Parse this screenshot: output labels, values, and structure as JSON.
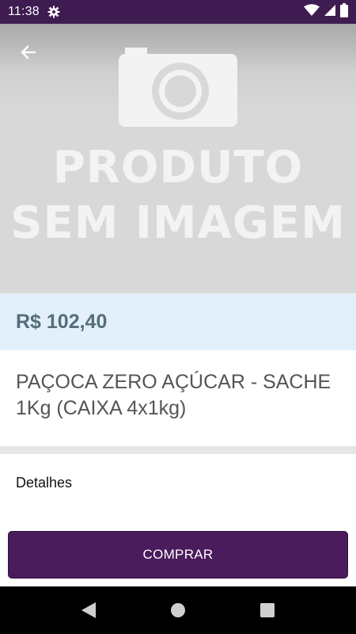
{
  "status_bar": {
    "time": "11:38",
    "icons": [
      "gear-icon",
      "wifi-icon",
      "signal-icon",
      "battery-icon"
    ],
    "color": "#3e1c52"
  },
  "product": {
    "image_placeholder": {
      "line1": "PRODUTO",
      "line2": "SEM IMAGEM",
      "icon": "camera-icon"
    },
    "price": "R$ 102,40",
    "name": "PAÇOCA ZERO AÇÚCAR - SACHE 1Kg (CAIXA 4x1kg)",
    "details_label": "Detalhes"
  },
  "actions": {
    "back_icon": "arrow-left-icon",
    "buy_label": "COMPRAR"
  },
  "navigation": {
    "buttons": [
      "nav-back-icon",
      "nav-home-icon",
      "nav-recents-icon"
    ]
  },
  "colors": {
    "accent": "#4a1c5c",
    "price_band": "#e3f0fb",
    "price_text": "#546e7a"
  }
}
